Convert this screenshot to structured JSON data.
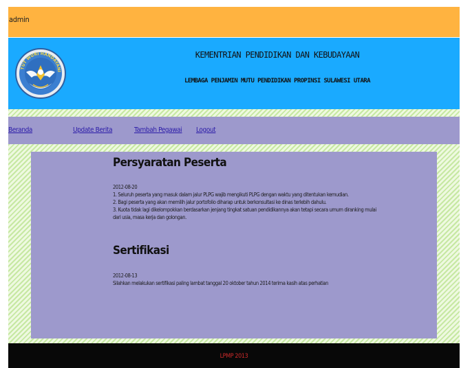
{
  "topbar": {
    "user": "admin"
  },
  "header": {
    "logo_text": "TUT WURI HANDAYANI",
    "title": "KEMENTRIAN PENDIDIKAN DAN KEBUDAYAAN",
    "subtitle": "LEMBAGA PENJAMIN MUTU PENDIDIKAN PROPINSI SULAWESI UTARA"
  },
  "nav": {
    "items": [
      {
        "label": "Beranda"
      },
      {
        "label": "Update Berita"
      },
      {
        "label": "Tambah Pegawai"
      },
      {
        "label": "Logout"
      }
    ]
  },
  "posts": [
    {
      "title": "Persyaratan Peserta",
      "date": "2012-08-20",
      "lines": [
        "1. Seluruh peserta yang masuk dalam jalur PLPG wajib mengikuti PLPG dengan waktu yang ditentukan kemudian.",
        "2. Bagi peserta yang akan memilih jalur portofolio diharap untuk berkonsultasi ke dinas terlebih dahulu.",
        "3. Kuota tidak lagi dikelompokkan berdasarkan jenjang tingkat satuan pendidikannya akan tetapi secara umum diranking mulai",
        "dari usia, masa kerja dan golongan."
      ]
    },
    {
      "title": "Sertifikasi",
      "date": "2012-08-13",
      "lines": [
        "Silahkan melakukan sertifikasi paling lambat tanggal 20 oktober tahun 2014 terima kasih atas perhatian"
      ]
    }
  ],
  "footer": {
    "text": "LPMP 2013"
  },
  "colors": {
    "topbar": "#ffb340",
    "header": "#1aaaff",
    "nav_content": "#9d99cc",
    "link": "#2a1aa8",
    "footer_text": "#cc2a2a"
  }
}
